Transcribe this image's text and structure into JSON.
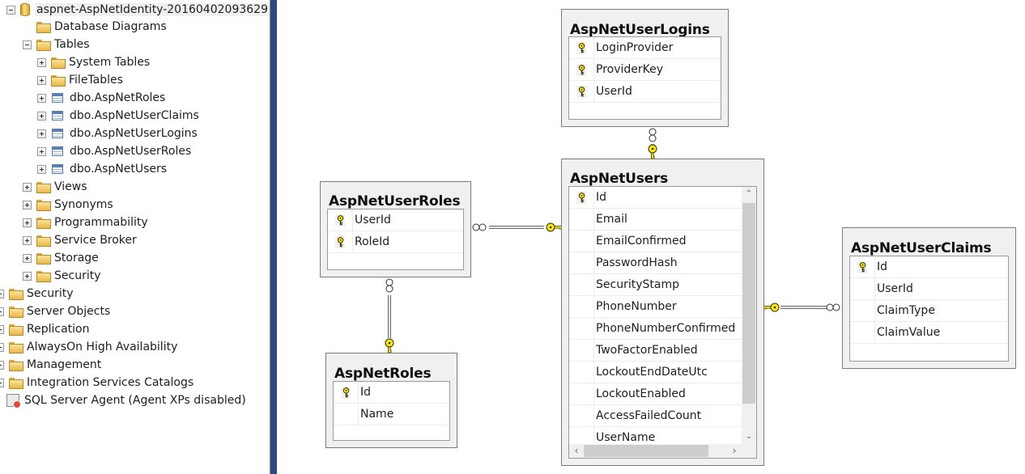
{
  "explorer": {
    "database": "aspnet-AspNetIdentity-20160402093629",
    "nodes": [
      {
        "label": "Database Diagrams"
      },
      {
        "label": "Tables"
      },
      {
        "label": "System Tables"
      },
      {
        "label": "FileTables"
      },
      {
        "label": "dbo.AspNetRoles"
      },
      {
        "label": "dbo.AspNetUserClaims"
      },
      {
        "label": "dbo.AspNetUserLogins"
      },
      {
        "label": "dbo.AspNetUserRoles"
      },
      {
        "label": "dbo.AspNetUsers"
      },
      {
        "label": "Views"
      },
      {
        "label": "Synonyms"
      },
      {
        "label": "Programmability"
      },
      {
        "label": "Service Broker"
      },
      {
        "label": "Storage"
      },
      {
        "label": "Security"
      }
    ],
    "server_nodes": [
      {
        "label": "Security"
      },
      {
        "label": "Server Objects"
      },
      {
        "label": "Replication"
      },
      {
        "label": "AlwaysOn High Availability"
      },
      {
        "label": "Management"
      },
      {
        "label": "Integration Services Catalogs"
      },
      {
        "label": "SQL Server Agent (Agent XPs disabled)"
      }
    ]
  },
  "diagram": {
    "colors": {
      "key": "#f5e61a",
      "key_outline": "#3a3000",
      "line": "#9a9a9a"
    },
    "tables": {
      "logins": {
        "name": "AspNetUserLogins",
        "columns": [
          {
            "name": "LoginProvider",
            "pk": true
          },
          {
            "name": "ProviderKey",
            "pk": true
          },
          {
            "name": "UserId",
            "pk": true
          }
        ]
      },
      "users": {
        "name": "AspNetUsers",
        "columns": [
          {
            "name": "Id",
            "pk": true
          },
          {
            "name": "Email",
            "pk": false
          },
          {
            "name": "EmailConfirmed",
            "pk": false
          },
          {
            "name": "PasswordHash",
            "pk": false
          },
          {
            "name": "SecurityStamp",
            "pk": false
          },
          {
            "name": "PhoneNumber",
            "pk": false
          },
          {
            "name": "PhoneNumberConfirmed",
            "pk": false
          },
          {
            "name": "TwoFactorEnabled",
            "pk": false
          },
          {
            "name": "LockoutEndDateUtc",
            "pk": false
          },
          {
            "name": "LockoutEnabled",
            "pk": false
          },
          {
            "name": "AccessFailedCount",
            "pk": false
          },
          {
            "name": "UserName",
            "pk": false
          }
        ]
      },
      "userroles": {
        "name": "AspNetUserRoles",
        "columns": [
          {
            "name": "UserId",
            "pk": true
          },
          {
            "name": "RoleId",
            "pk": true
          }
        ]
      },
      "roles": {
        "name": "AspNetRoles",
        "columns": [
          {
            "name": "Id",
            "pk": true
          },
          {
            "name": "Name",
            "pk": false
          }
        ]
      },
      "claims": {
        "name": "AspNetUserClaims",
        "columns": [
          {
            "name": "Id",
            "pk": true
          },
          {
            "name": "UserId",
            "pk": false
          },
          {
            "name": "ClaimType",
            "pk": false
          },
          {
            "name": "ClaimValue",
            "pk": false
          }
        ]
      }
    },
    "relationships": [
      {
        "from": "AspNetUserLogins",
        "to": "AspNetUsers",
        "many": "AspNetUserLogins",
        "one": "AspNetUsers"
      },
      {
        "from": "AspNetUserRoles",
        "to": "AspNetUsers",
        "many": "AspNetUserRoles",
        "one": "AspNetUsers"
      },
      {
        "from": "AspNetUserRoles",
        "to": "AspNetRoles",
        "many": "AspNetUserRoles",
        "one": "AspNetRoles"
      },
      {
        "from": "AspNetUserClaims",
        "to": "AspNetUsers",
        "many": "AspNetUserClaims",
        "one": "AspNetUsers"
      }
    ],
    "scroll": {
      "up": "⌃",
      "down": "⌄",
      "left": "‹",
      "right": "›"
    }
  }
}
